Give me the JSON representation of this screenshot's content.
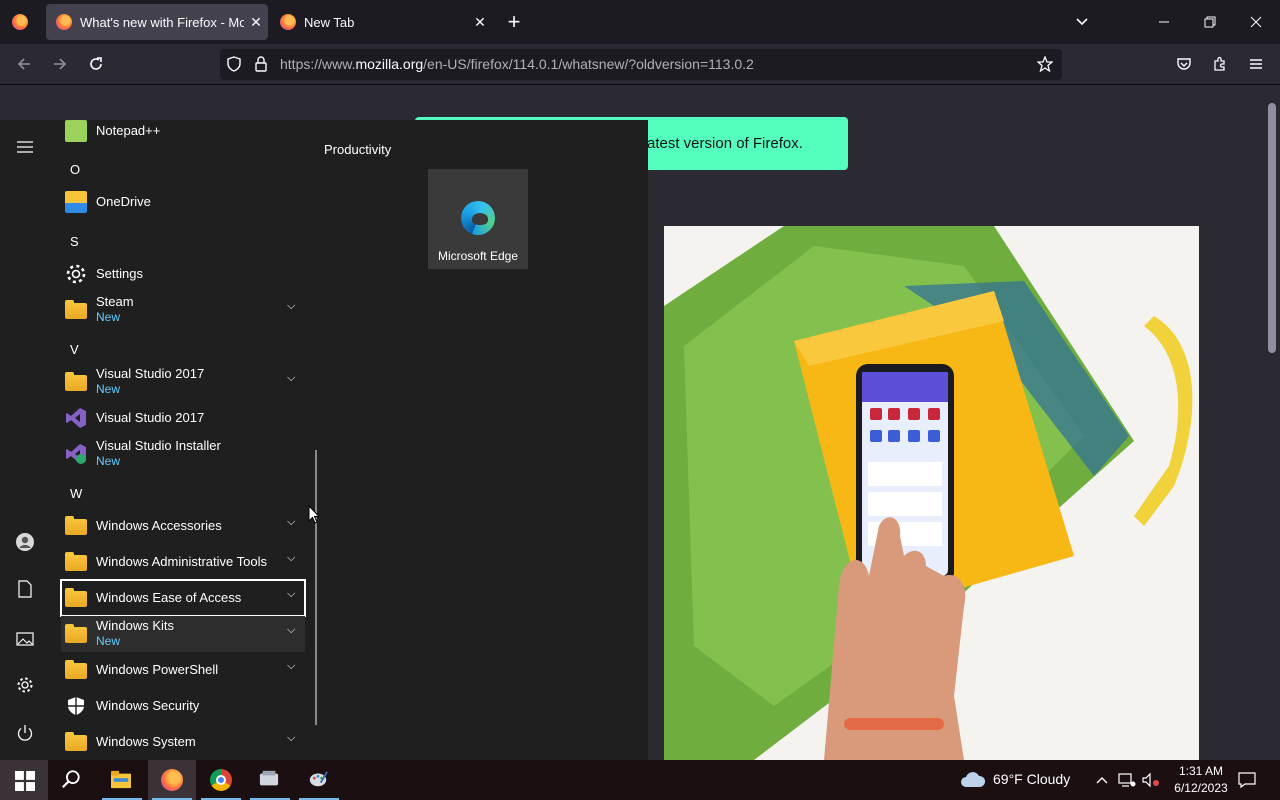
{
  "browser": {
    "tabs": [
      {
        "title": "What's new with Firefox - More",
        "active": true
      },
      {
        "title": "New Tab",
        "active": false
      }
    ],
    "new_tab_label": "+",
    "url_prefix": "https://www.",
    "url_domain": "mozilla.org",
    "url_path": "/en-US/firefox/114.0.1/whatsnew/?oldversion=113.0.2"
  },
  "page": {
    "banner_text": "atest version of Firefox."
  },
  "start_menu": {
    "tile_group": "Productivity",
    "tile": {
      "label": "Microsoft Edge"
    },
    "letters": {
      "o": "O",
      "s": "S",
      "v": "V",
      "w": "W"
    },
    "apps": {
      "notepad": {
        "name": "Notepad++"
      },
      "onedrive": {
        "name": "OneDrive"
      },
      "settings": {
        "name": "Settings"
      },
      "steam": {
        "name": "Steam",
        "sub": "New"
      },
      "vs2017_folder": {
        "name": "Visual Studio 2017",
        "sub": "New"
      },
      "vs2017": {
        "name": "Visual Studio 2017"
      },
      "vs_installer": {
        "name": "Visual Studio Installer",
        "sub": "New"
      },
      "win_accessories": {
        "name": "Windows Accessories"
      },
      "win_admin": {
        "name": "Windows Administrative Tools"
      },
      "win_ease": {
        "name": "Windows Ease of Access"
      },
      "win_kits": {
        "name": "Windows Kits",
        "sub": "New"
      },
      "win_powershell": {
        "name": "Windows PowerShell"
      },
      "win_security": {
        "name": "Windows Security"
      },
      "win_system": {
        "name": "Windows System"
      }
    }
  },
  "taskbar": {
    "weather": "69°F  Cloudy",
    "time": "1:31 AM",
    "date": "6/12/2023"
  },
  "colors": {
    "accent": "#60cdff",
    "banner": "#54ffbd",
    "folder": "#f8c43a"
  }
}
